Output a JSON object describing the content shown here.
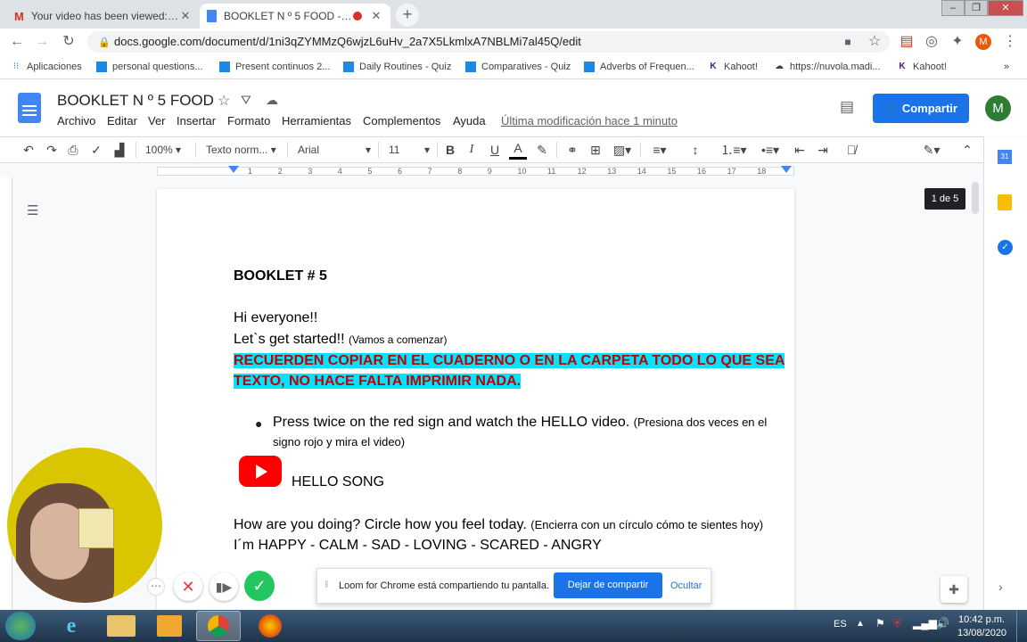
{
  "tabs": [
    {
      "title": "Your video has been viewed: BO",
      "icon": "gmail-icon"
    },
    {
      "title": "BOOKLET N º 5 FOOD - Docs",
      "icon": "docs-icon"
    }
  ],
  "url": "docs.google.com/document/d/1ni3qZYMMzQ6wjzL6uHv_2a7X5LkmlxA7NBLMi7al45Q/edit",
  "bookmarks": [
    "Aplicaciones",
    "personal questions...",
    "Present continuos 2...",
    "Daily Routines - Quiz",
    "Comparatives - Quiz",
    "Adverbs of Frequen...",
    "Kahoot!",
    "https://nuvola.madi...",
    "Kahoot!"
  ],
  "doc": {
    "title": "BOOKLET N º 5 FOOD",
    "menus": [
      "Archivo",
      "Editar",
      "Ver",
      "Insertar",
      "Formato",
      "Herramientas",
      "Complementos",
      "Ayuda"
    ],
    "last_modified": "Última modificación hace 1 minuto",
    "share_label": "Compartir",
    "avatar_letter": "M"
  },
  "toolbar": {
    "zoom": "100%",
    "style": "Texto norm...",
    "font": "Arial",
    "size": "11"
  },
  "ruler_marks": [
    "1",
    "2",
    "3",
    "4",
    "5",
    "6",
    "7",
    "8",
    "9",
    "10",
    "11",
    "12",
    "13",
    "14",
    "15",
    "16",
    "17",
    "18"
  ],
  "page_badge": "1 de 5",
  "content": {
    "heading": "BOOKLET # 5",
    "greeting": "Hi everyone!!",
    "lets_start": "Let`s get started!!",
    "lets_start_es": "(Vamos a comenzar)",
    "highlight": "RECUERDEN COPIAR EN EL CUADERNO O EN LA CARPETA TODO LO QUE SEA TEXTO, NO HACE FALTA IMPRIMIR NADA.",
    "bullet": "Press twice on the red sign and watch the HELLO video.",
    "bullet_es_1": "(Presiona dos veces en el",
    "bullet_es_2": "signo rojo y mira el video)",
    "song": "HELLO SONG",
    "how": "How are you doing? Circle how you feel today.",
    "how_es": "(Encierra con un círculo cómo te sientes hoy)",
    "feelings": "I´m HAPPY -  CALM -  SAD - LOVING - SCARED -  ANGRY"
  },
  "loom": {
    "message": "Loom for Chrome está compartiendo tu pantalla.",
    "stop": "Dejar de compartir",
    "hide": "Ocultar"
  },
  "taskbar": {
    "lang": "ES",
    "time": "10:42 p.m.",
    "date": "13/08/2020"
  }
}
